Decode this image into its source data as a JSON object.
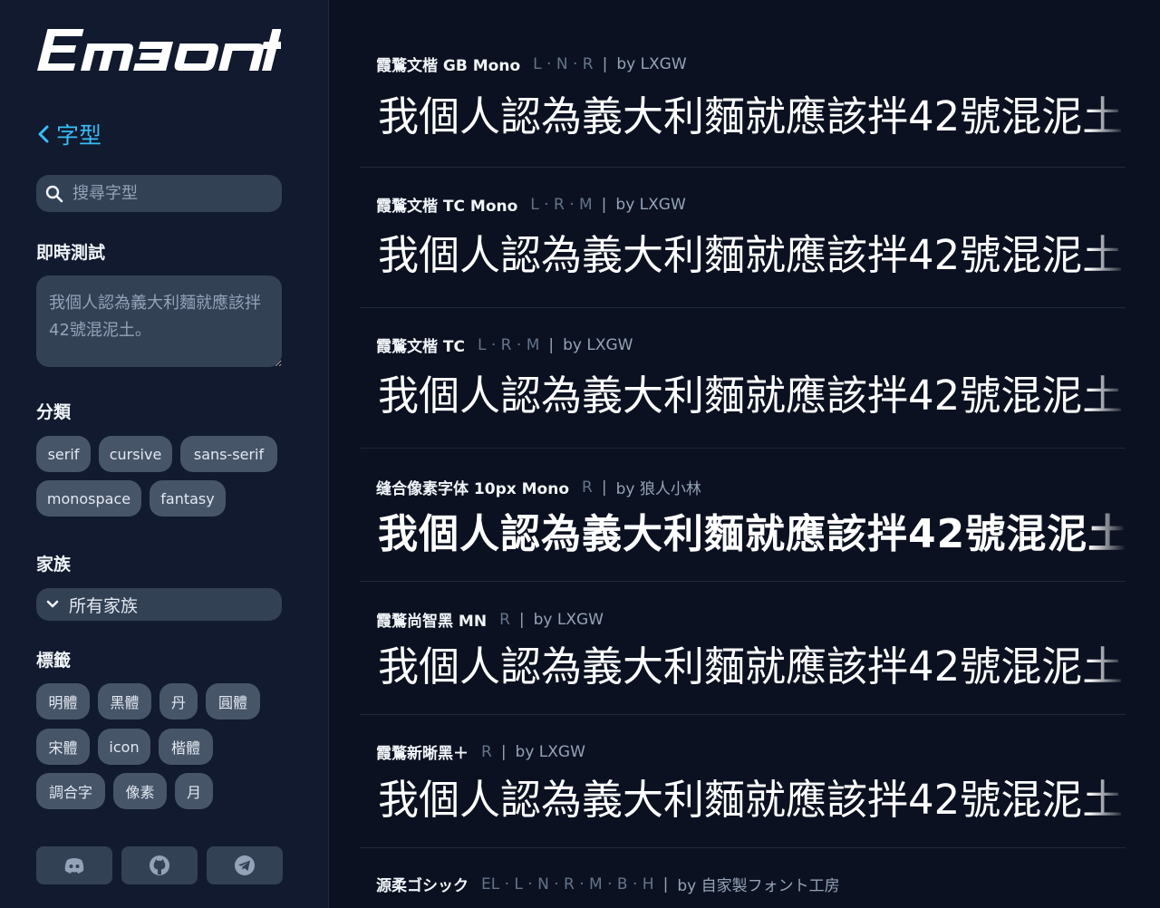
{
  "app": {
    "logo_text": "Emfont"
  },
  "sidebar": {
    "back_label": "字型",
    "search_placeholder": "搜尋字型",
    "live_test": {
      "title": "即時測試",
      "placeholder": "我個人認為義大利麵就應該拌42號混泥土。"
    },
    "categories": {
      "title": "分類",
      "items": [
        "serif",
        "cursive",
        "sans-serif",
        "monospace",
        "fantasy"
      ]
    },
    "family": {
      "title": "家族",
      "selected": "所有家族"
    },
    "tags": {
      "title": "標籤",
      "items": [
        "明體",
        "黑體",
        "丹",
        "圓體",
        "宋體",
        "icon",
        "楷體",
        "調合字",
        "像素",
        "月"
      ]
    },
    "social": [
      "discord-icon",
      "github-icon",
      "telegram-icon"
    ]
  },
  "preview_text": "我個人認為義大利麵就應該拌42號混泥土",
  "fonts": [
    {
      "name": "霞鶩文楷 GB Mono",
      "weights": "L · N · R",
      "by": "by LXGW"
    },
    {
      "name": "霞鶩文楷 TC Mono",
      "weights": "L · R · M",
      "by": "by LXGW"
    },
    {
      "name": "霞鶩文楷 TC",
      "weights": "L · R · M",
      "by": "by LXGW"
    },
    {
      "name": "缝合像素字体 10px Mono",
      "weights": "R",
      "by": "by 狼人小林"
    },
    {
      "name": "霞鶩尚智黑 MN",
      "weights": "R",
      "by": "by LXGW"
    },
    {
      "name": "霞鶩新晰黑＋",
      "weights": "R",
      "by": "by LXGW"
    },
    {
      "name": "源柔ゴシック",
      "weights": "EL · L · N · R · M · B · H",
      "by": "by 自家製フォント工房"
    }
  ],
  "colors": {
    "accent": "#38bdf8",
    "bg": "#0b1120",
    "sidebar": "#111a2e",
    "chip": "#475569"
  }
}
